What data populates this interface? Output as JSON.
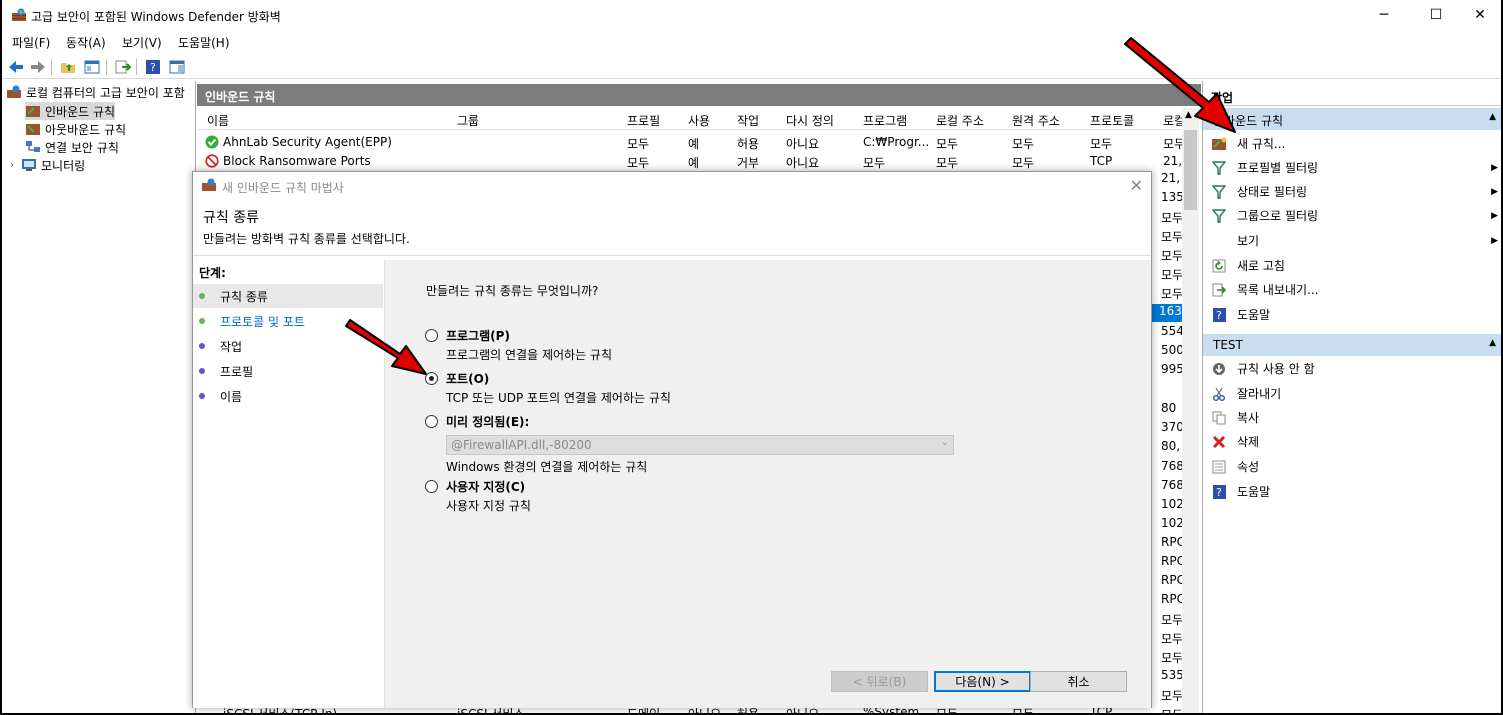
{
  "window": {
    "title": "고급 보안이 포함된 Windows Defender 방화벽",
    "controls": {
      "minimize": "─",
      "maximize": "☐",
      "close": "✕"
    }
  },
  "menu": [
    "파일(F)",
    "동작(A)",
    "보기(V)",
    "도움말(H)"
  ],
  "tree": {
    "root": "로컬 컴퓨터의 고급 보안이 포함",
    "items": [
      "인바운드 규칙",
      "아웃바운드 규칙",
      "연결 보안 규칙",
      "모니터링"
    ]
  },
  "center": {
    "header": "인바운드 규칙",
    "columns": [
      "이름",
      "그룹",
      "프로필",
      "사용",
      "작업",
      "다시 정의",
      "프로그램",
      "로컬 주소",
      "원격 주소",
      "프로토콜",
      "로컬"
    ],
    "rows": [
      {
        "name": "AhnLab Security Agent(EPP)",
        "group": "",
        "profile": "모두",
        "enabled": "예",
        "action": "허용",
        "override": "아니요",
        "program": "C:₩Progr...",
        "local": "모두",
        "remote": "모두",
        "protocol": "모두",
        "lport": "모두"
      },
      {
        "name": "Block Ransomware Ports",
        "group": "",
        "profile": "모두",
        "enabled": "예",
        "action": "거부",
        "override": "아니요",
        "program": "모두",
        "local": "모두",
        "remote": "모두",
        "protocol": "TCP",
        "lport": "21,"
      }
    ],
    "bottom_row": {
      "name": "iSCSI 서비스(TCP-In)",
      "group": "iSCSI 서비스",
      "profile": "도메인",
      "enabled": "아니요",
      "action": "허용",
      "override": "아니요",
      "program": "%System...",
      "local": "모두",
      "remote": "모두",
      "protocol": "TCP"
    },
    "right_values": [
      "21,",
      "135",
      "모두",
      "모두",
      "모두",
      "모두",
      "모두",
      "163",
      "554",
      "500",
      "995",
      "80",
      "370",
      "80,",
      "768",
      "768",
      "102",
      "102",
      "RPC",
      "RPC",
      "RPC",
      "RPC",
      "모두",
      "모두",
      "모두",
      "535",
      "모두",
      "모두"
    ]
  },
  "actions": {
    "title": "작업",
    "section1": "인바운드 규칙",
    "items1": [
      "새 규칙...",
      "프로필별 필터링",
      "상태로 필터링",
      "그룹으로 필터링",
      "보기",
      "새로 고침",
      "목록 내보내기...",
      "도움말"
    ],
    "section2": "TEST",
    "items2": [
      "규칙 사용 안 함",
      "잘라내기",
      "복사",
      "삭제",
      "속성",
      "도움말"
    ]
  },
  "dialog": {
    "title": "새 인바운드 규칙 마법사",
    "heading": "규칙 종류",
    "subheading": "만들려는 방화벽 규칙 종류를 선택합니다.",
    "steps_label": "단계:",
    "steps": [
      "규칙 종류",
      "프로토콜 및 포트",
      "작업",
      "프로필",
      "이름"
    ],
    "question": "만들려는 규칙 종류는 무엇입니까?",
    "options": [
      {
        "label": "프로그램(P)",
        "desc": "프로그램의 연결을 제어하는 규칙"
      },
      {
        "label": "포트(O)",
        "desc": "TCP 또는 UDP 포트의 연결을 제어하는 규칙"
      },
      {
        "label": "미리 정의됨(E):",
        "desc": "Windows 환경의 연결을 제어하는 규칙"
      },
      {
        "label": "사용자 지정(C)",
        "desc": "사용자 지정 규칙"
      }
    ],
    "predefined_value": "@FirewallAPI.dll,-80200",
    "selected_option": "포트(O)",
    "buttons": {
      "back": "< 뒤로(B)",
      "next": "다음(N) >",
      "cancel": "취소"
    }
  },
  "colors": {
    "accent": "#0078d7",
    "header": "#7c7c7c",
    "section": "#c9ddf1",
    "arrow": "#e00000"
  }
}
